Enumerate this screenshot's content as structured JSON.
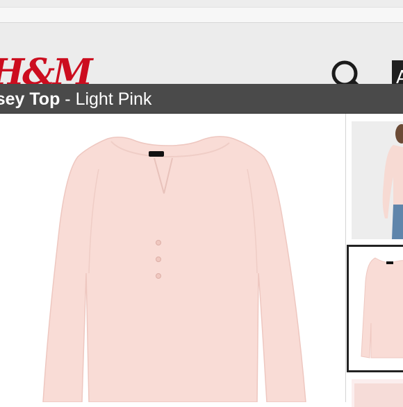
{
  "brand": {
    "logo_text": "H&M",
    "color": "#cc0d1f"
  },
  "header": {
    "search_icon": "search-icon",
    "account_letter": "A"
  },
  "product": {
    "name": "rsey Top",
    "separator": " - ",
    "color_name": "Light Pink",
    "shirt_color": "#f9dcd6"
  },
  "thumbnails": [
    {
      "description_icon": "model-photo-thumbnail"
    },
    {
      "description_icon": "product-photo-thumbnail",
      "selected": true
    },
    {
      "description_icon": "detail-photo-thumbnail"
    }
  ]
}
